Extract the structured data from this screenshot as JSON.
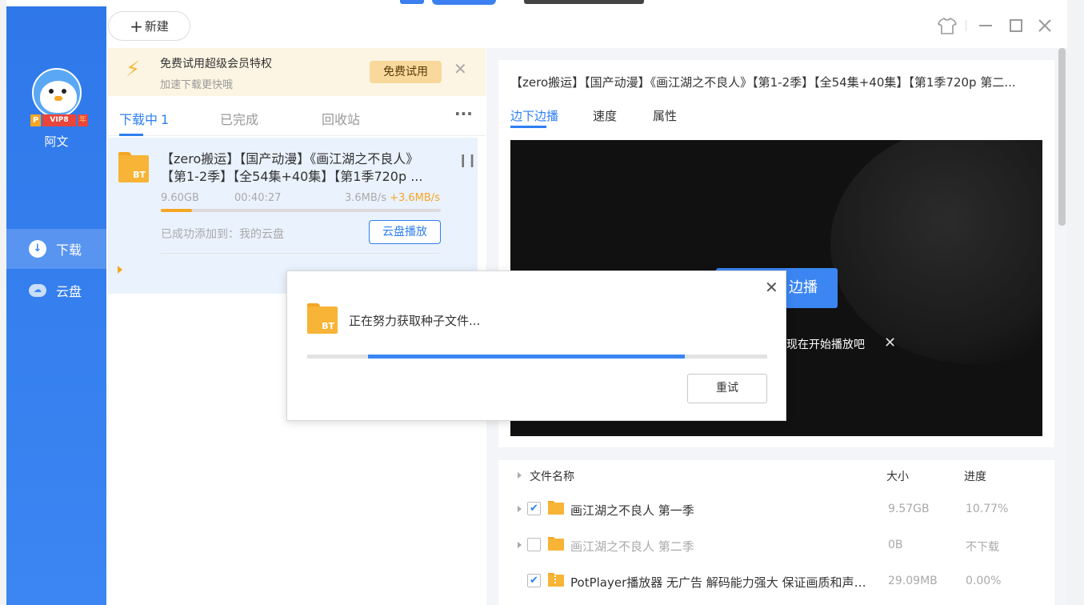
{
  "header": {
    "new_label": "新建"
  },
  "user": {
    "name": "阿文",
    "vip_badge": "VIP8",
    "badge_p": "P",
    "badge_year": "年"
  },
  "nav": [
    {
      "label": "下载",
      "active": true
    },
    {
      "label": "云盘",
      "active": false
    }
  ],
  "promo": {
    "title": "免费试用超级会员特权",
    "subtitle": "加速下载更快哦",
    "button": "免费试用"
  },
  "tabs": {
    "downloading": "下载中",
    "downloading_count": "1",
    "completed": "已完成",
    "recycle": "回收站",
    "more": "···"
  },
  "task": {
    "title": "【zero搬运】【国产动漫】《画江湖之不良人》【第1-2季】【全54集+40集】【第1季720p ...",
    "size": "9.60GB",
    "time": "00:40:27",
    "speed": "3.6MB/s",
    "boost": "+3.6MB/s",
    "progress": 0.11,
    "added": "已成功添加到：我的云盘",
    "cloud_play": "云盘播放",
    "icon_label": "BT"
  },
  "detail": {
    "title": "【zero搬运】【国产动漫】《画江湖之不良人》【第1-2季】【全54集+40集】【第1季720p 第二...",
    "tabs": [
      "边下边播",
      "速度",
      "属性"
    ],
    "play_button": "边播",
    "tip": "现在开始播放吧"
  },
  "files": {
    "headers": {
      "name": "文件名称",
      "size": "大小",
      "progress": "进度"
    },
    "rows": [
      {
        "name": "画江湖之不良人 第一季",
        "size": "9.57GB",
        "progress": "10.77%",
        "checked": true
      },
      {
        "name": "画江湖之不良人 第二季",
        "size": "0B",
        "progress": "不下载",
        "checked": false
      },
      {
        "name": "PotPlayer播放器 无广告 解码能力强大 保证画质和声音...",
        "size": "29.09MB",
        "progress": "0.00%",
        "checked": true
      }
    ]
  },
  "dialog": {
    "message": "正在努力获取种子文件...",
    "progress": 0.82,
    "retry": "重试",
    "icon_label": "BT"
  },
  "colors": {
    "accent": "#2e7ff2",
    "sidebar": "#3b86f3",
    "warning": "#f5a623"
  }
}
